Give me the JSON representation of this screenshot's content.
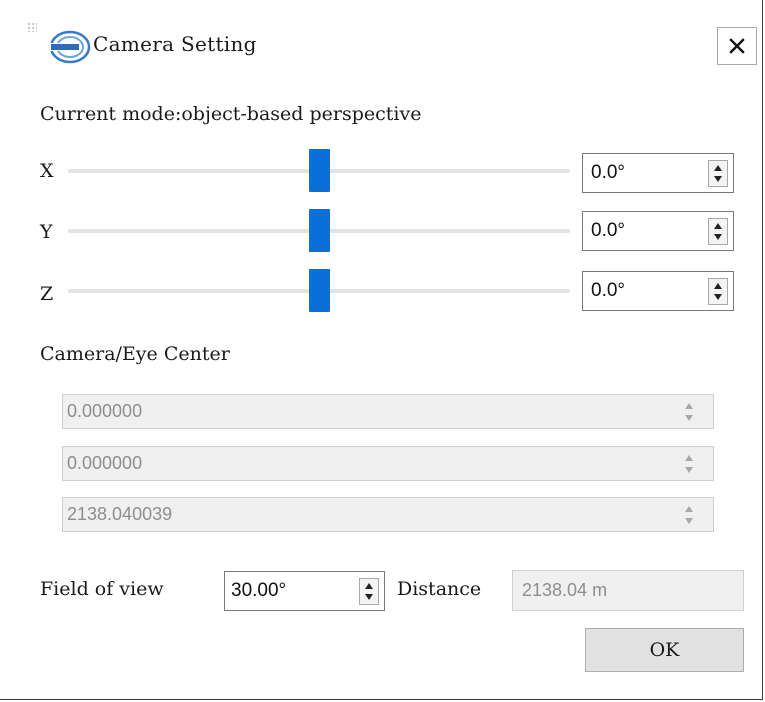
{
  "window": {
    "title": "Camera Setting",
    "close_icon": "close-icon",
    "logo_icon": "app-logo-icon"
  },
  "mode": {
    "text": "Current mode:object-based perspective"
  },
  "rotation": {
    "x": {
      "label": "X",
      "value": "0.0°",
      "slider_fraction": 0.5
    },
    "y": {
      "label": "Y",
      "value": "0.0°",
      "slider_fraction": 0.5
    },
    "z": {
      "label": "Z",
      "value": "0.0°",
      "slider_fraction": 0.5
    }
  },
  "camera_center": {
    "heading": "Camera/Eye Center",
    "values": [
      "0.000000",
      "0.000000",
      "2138.040039"
    ]
  },
  "fov": {
    "label": "Field of view",
    "value": "30.00°"
  },
  "distance": {
    "label": "Distance",
    "value": "2138.04 m"
  },
  "buttons": {
    "ok": "OK"
  },
  "colors": {
    "slider_handle": "#0a6fd9",
    "disabled_text": "#8e8e8e"
  }
}
